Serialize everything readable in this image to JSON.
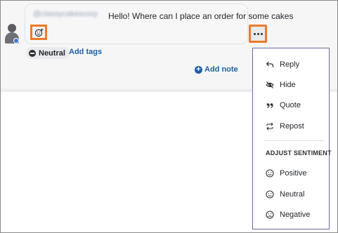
{
  "message": {
    "author": "@classycakescorp",
    "text": "Hello! Where can I place an order for some cakes"
  },
  "sentiment_chip": {
    "label": "Neutral"
  },
  "actions": {
    "add_tags": "Add tags",
    "add_note": "Add note"
  },
  "menu": {
    "items": [
      {
        "label": "Reply",
        "icon": "reply-icon"
      },
      {
        "label": "Hide",
        "icon": "eye-off-icon"
      },
      {
        "label": "Quote",
        "icon": "quote-icon"
      },
      {
        "label": "Repost",
        "icon": "repost-icon"
      }
    ],
    "sentiment_heading": "ADJUST SENTIMENT",
    "sentiment_items": [
      {
        "label": "Positive",
        "icon": "smile-icon"
      },
      {
        "label": "Neutral",
        "icon": "neutral-face-icon"
      },
      {
        "label": "Negative",
        "icon": "frown-icon"
      }
    ]
  },
  "colors": {
    "highlight": "#ec7a2a",
    "link": "#1f5fa3",
    "menu_border": "#6f69a3"
  }
}
